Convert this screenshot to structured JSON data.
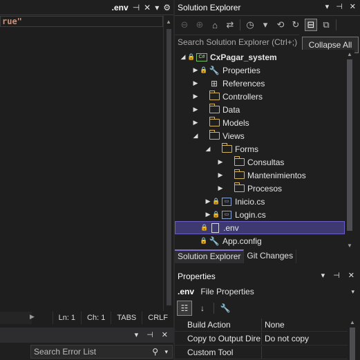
{
  "editor": {
    "tab_label": ".env",
    "code_line": "rue\"",
    "status": {
      "ln": "Ln: 1",
      "ch": "Ch: 1",
      "indent": "TABS",
      "eol": "CRLF"
    }
  },
  "error_list": {
    "search_placeholder": "Search Error List"
  },
  "solution_explorer": {
    "title": "Solution Explorer",
    "search_placeholder": "Search Solution Explorer (Ctrl+;)",
    "tooltip": "Collapse All",
    "tree": [
      {
        "label": "CxPagar_system"
      },
      {
        "label": "Properties"
      },
      {
        "label": "References"
      },
      {
        "label": "Controllers"
      },
      {
        "label": "Data"
      },
      {
        "label": "Models"
      },
      {
        "label": "Views"
      },
      {
        "label": "Forms"
      },
      {
        "label": "Consultas"
      },
      {
        "label": "Mantenimientos"
      },
      {
        "label": "Procesos"
      },
      {
        "label": "Inicio.cs"
      },
      {
        "label": "Login.cs"
      },
      {
        "label": ".env"
      },
      {
        "label": "App.config"
      }
    ],
    "tabs": [
      "Solution Explorer",
      "Git Changes"
    ]
  },
  "properties": {
    "title": "Properties",
    "object_name": ".env",
    "object_type": "File Properties",
    "rows": [
      {
        "name": "Build Action",
        "value": "None"
      },
      {
        "name": "Copy to Output Dire",
        "value": "Do not copy"
      },
      {
        "name": "Custom Tool",
        "value": ""
      }
    ]
  },
  "colors": {
    "accent": "#6b5fc7",
    "selection": "#3f3971",
    "folder": "#d8b45a",
    "background": "#1f1f1f"
  }
}
